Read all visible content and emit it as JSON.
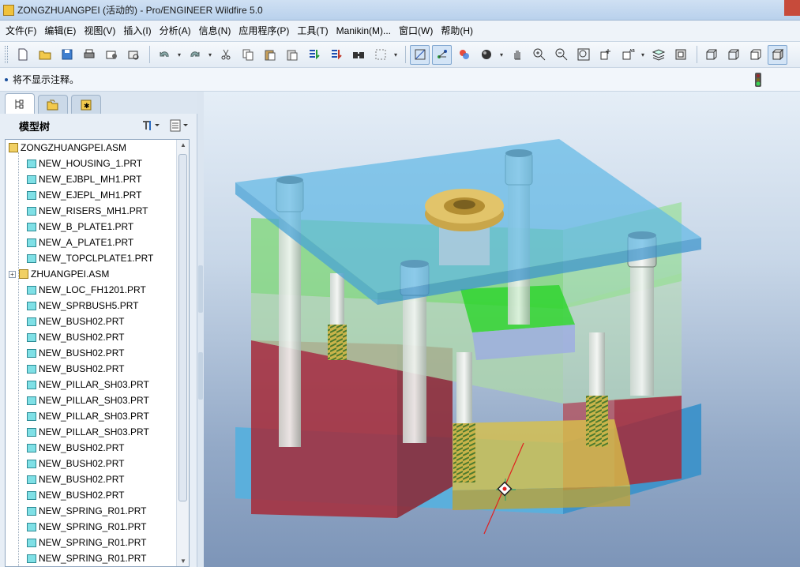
{
  "window": {
    "title": "ZONGZHUANGPEI (活动的) - Pro/ENGINEER Wildfire 5.0"
  },
  "menu": [
    "文件(F)",
    "编辑(E)",
    "视图(V)",
    "插入(I)",
    "分析(A)",
    "信息(N)",
    "应用程序(P)",
    "工具(T)",
    "Manikin(M)...",
    "窗口(W)",
    "帮助(H)"
  ],
  "toolbar": {
    "icons": [
      "new-file-icon",
      "open-folder-icon",
      "save-icon",
      "print-icon",
      "send-mail-icon",
      "email-link-icon",
      "undo-icon",
      "redo-icon",
      "cut-icon",
      "copy-icon",
      "paste-icon",
      "paste-special-icon",
      "regenerate-icon",
      "regenerate-manager-icon",
      "find-icon",
      "select-box-icon",
      "datum-display-icon",
      "spin-center-icon",
      "saved-views-icon",
      "appearance-icon",
      "pan-icon",
      "zoom-in-icon",
      "zoom-out-icon",
      "refit-icon",
      "reorient-icon",
      "view-manager-icon",
      "layers-icon",
      "model-display-icon",
      "wireframe-icon",
      "hidden-line-icon",
      "no-hidden-icon",
      "shading-icon"
    ]
  },
  "message": {
    "text": "将不显示注释。"
  },
  "navigator": {
    "header": "模型树",
    "tabs": [
      "model-tree-tab",
      "folder-browser-tab",
      "favorites-tab"
    ],
    "tree": [
      {
        "label": "ZONGZHUANGPEI.ASM",
        "kind": "asm",
        "level": 0
      },
      {
        "label": "NEW_HOUSING_1.PRT",
        "kind": "part",
        "level": 1
      },
      {
        "label": "NEW_EJBPL_MH1.PRT",
        "kind": "part",
        "level": 1
      },
      {
        "label": "NEW_EJEPL_MH1.PRT",
        "kind": "part",
        "level": 1
      },
      {
        "label": "NEW_RISERS_MH1.PRT",
        "kind": "part",
        "level": 1
      },
      {
        "label": "NEW_B_PLATE1.PRT",
        "kind": "part",
        "level": 1
      },
      {
        "label": "NEW_A_PLATE1.PRT",
        "kind": "part",
        "level": 1
      },
      {
        "label": "NEW_TOPCLPLATE1.PRT",
        "kind": "part",
        "level": 1
      },
      {
        "label": "ZHUANGPEI.ASM",
        "kind": "subasm",
        "level": 1
      },
      {
        "label": "NEW_LOC_FH1201.PRT",
        "kind": "part",
        "level": 1
      },
      {
        "label": "NEW_SPRBUSH5.PRT",
        "kind": "part",
        "level": 1
      },
      {
        "label": "NEW_BUSH02.PRT",
        "kind": "part",
        "level": 1
      },
      {
        "label": "NEW_BUSH02.PRT",
        "kind": "part",
        "level": 1
      },
      {
        "label": "NEW_BUSH02.PRT",
        "kind": "part",
        "level": 1
      },
      {
        "label": "NEW_BUSH02.PRT",
        "kind": "part",
        "level": 1
      },
      {
        "label": "NEW_PILLAR_SH03.PRT",
        "kind": "part",
        "level": 1
      },
      {
        "label": "NEW_PILLAR_SH03.PRT",
        "kind": "part",
        "level": 1
      },
      {
        "label": "NEW_PILLAR_SH03.PRT",
        "kind": "part",
        "level": 1
      },
      {
        "label": "NEW_PILLAR_SH03.PRT",
        "kind": "part",
        "level": 1
      },
      {
        "label": "NEW_BUSH02.PRT",
        "kind": "part",
        "level": 1
      },
      {
        "label": "NEW_BUSH02.PRT",
        "kind": "part",
        "level": 1
      },
      {
        "label": "NEW_BUSH02.PRT",
        "kind": "part",
        "level": 1
      },
      {
        "label": "NEW_BUSH02.PRT",
        "kind": "part",
        "level": 1
      },
      {
        "label": "NEW_SPRING_R01.PRT",
        "kind": "part",
        "level": 1
      },
      {
        "label": "NEW_SPRING_R01.PRT",
        "kind": "part",
        "level": 1
      },
      {
        "label": "NEW_SPRING_R01.PRT",
        "kind": "part",
        "level": 1
      },
      {
        "label": "NEW_SPRING_R01.PRT",
        "kind": "part",
        "level": 1
      }
    ]
  },
  "colors": {
    "top_plate": "#5fb8e6",
    "a_plate": "#8fe08a",
    "b_plate": "#b7dcb1",
    "risers": "#b3343f",
    "ejector_zone": "#d8c14a",
    "sprue_bushing": "#e2c46a",
    "bottom_plate": "#5fb8e6"
  }
}
